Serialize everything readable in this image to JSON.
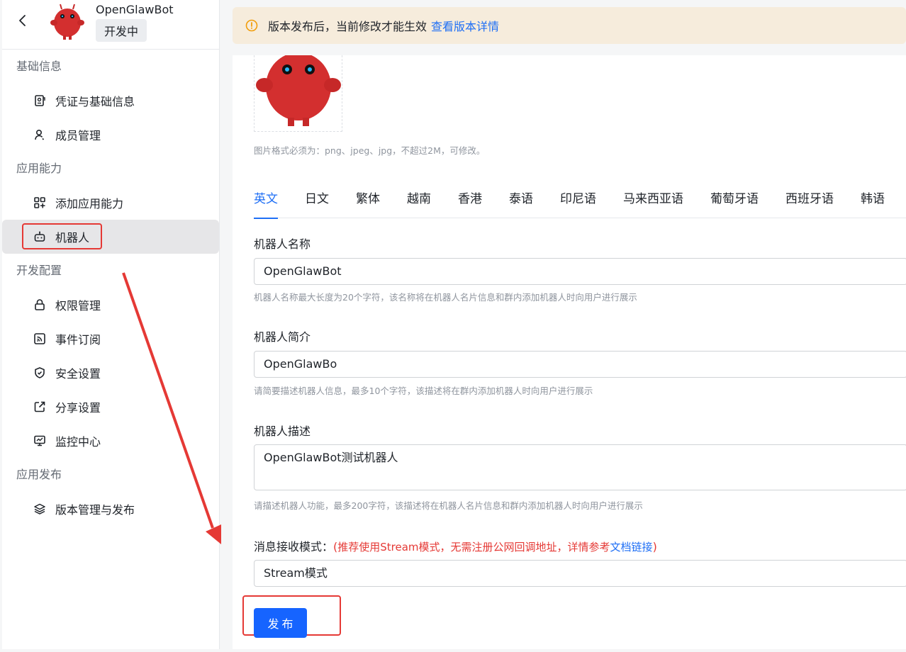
{
  "app": {
    "name": "OpenGlawBot",
    "status": "开发中"
  },
  "sidebar": {
    "sections": [
      {
        "title": "基础信息",
        "items": [
          {
            "label": "凭证与基础信息",
            "icon": "credential-icon"
          },
          {
            "label": "成员管理",
            "icon": "user-icon"
          }
        ]
      },
      {
        "title": "应用能力",
        "items": [
          {
            "label": "添加应用能力",
            "icon": "grid-add-icon"
          },
          {
            "label": "机器人",
            "icon": "robot-icon",
            "active": true
          }
        ]
      },
      {
        "title": "开发配置",
        "items": [
          {
            "label": "权限管理",
            "icon": "lock-icon"
          },
          {
            "label": "事件订阅",
            "icon": "rss-icon"
          },
          {
            "label": "安全设置",
            "icon": "shield-icon"
          },
          {
            "label": "分享设置",
            "icon": "share-icon"
          },
          {
            "label": "监控中心",
            "icon": "monitor-icon"
          }
        ]
      },
      {
        "title": "应用发布",
        "items": [
          {
            "label": "版本管理与发布",
            "icon": "layers-icon"
          }
        ]
      }
    ]
  },
  "notice": {
    "text": "版本发布后，当前修改才能生效",
    "link": "查看版本详情",
    "color": "#f6ecdc"
  },
  "logo_hint": "图片格式必须为：png、jpeg、jpg，不超过2M，可修改。",
  "tabs": [
    "英文",
    "日文",
    "繁体",
    "越南",
    "香港",
    "泰语",
    "印尼语",
    "马来西亚语",
    "葡萄牙语",
    "西班牙语",
    "韩语"
  ],
  "active_tab": "英文",
  "form": {
    "name_label": "机器人名称",
    "name_value": "OpenGlawBot",
    "name_hint": "机器人名称最大长度为20个字符，该名称将在机器人名片信息和群内添加机器人时向用户进行展示",
    "intro_label": "机器人简介",
    "intro_value": "OpenGlawBo",
    "intro_hint": "请简要描述机器人信息，最多10个字符，该描述将在群内添加机器人时向用户进行展示",
    "desc_label": "机器人描述",
    "desc_value": "OpenGlawBot测试机器人",
    "desc_hint": "请描述机器人功能，最多200字符，该描述将在机器人名片信息和群内添加机器人时向用户进行展示",
    "mode_label": "消息接收模式：",
    "mode_note_open": "(",
    "mode_note": "推荐使用Stream模式，无需注册公网回调地址，详情参考",
    "mode_link": "文档链接",
    "mode_note_close": ")",
    "mode_value": "Stream模式"
  },
  "publish_label": "发布",
  "colors": {
    "accent": "#1664ff",
    "annotation_red": "#e53935"
  }
}
